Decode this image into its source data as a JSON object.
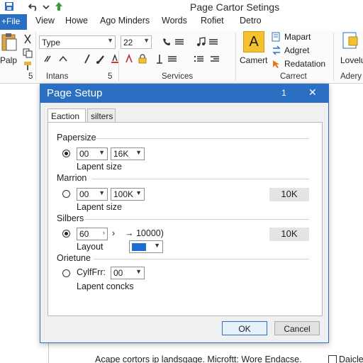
{
  "window": {
    "title": "Page Cartor Setings"
  },
  "tabs": [
    {
      "label": "+File"
    },
    {
      "label": "View"
    },
    {
      "label": "Howe"
    },
    {
      "label": "Ago Minders"
    },
    {
      "label": "Words"
    },
    {
      "label": "Rofiet"
    },
    {
      "label": "Detro"
    }
  ],
  "ribbon": {
    "paste_label": "Palp",
    "font_name": "Type",
    "font_size": "22",
    "group_labels": {
      "clipboard_num": "5",
      "intans": "Intans",
      "intans_num": "5",
      "services": "Services",
      "carrect": "Carrect",
      "adery": "Adery"
    },
    "camert_label": "Camert",
    "big_a": "A",
    "right_items": [
      "Mapart",
      "Adgret",
      "Redatation"
    ],
    "lovelu_label": "Lovelu"
  },
  "dialog": {
    "title": "Page Setup",
    "help": "1",
    "close": "✕",
    "tab1": "Eaction",
    "tab2": "silters",
    "sections": {
      "papersize": {
        "title": "Papersize",
        "sel1": "00",
        "sel2": "16K",
        "caption": "Lapent size"
      },
      "marrion": {
        "title": "Marrion",
        "sel1": "00",
        "sel2": "100K",
        "caption": "Lapent size",
        "value": "10K"
      },
      "silbers": {
        "title": "Silbers",
        "sel1": "60",
        "arrow_text": "→ 10000)",
        "caption": "Layout",
        "value": "10K",
        "layout_color": "#1f6fd1"
      },
      "orietune": {
        "title": "Orietune",
        "radio_label": "CylfFrr:",
        "sel1": "00",
        "caption": "Lapent concks"
      }
    },
    "ok": "OK",
    "cancel": "Cancel"
  },
  "status": {
    "text": "Acape cortors ip landsgage. Microftt: Wore Endacse.",
    "trailing": "Daicle"
  },
  "colors": {
    "accent": "#2b6fc2",
    "ribbon_gold": "#f5c12f"
  }
}
